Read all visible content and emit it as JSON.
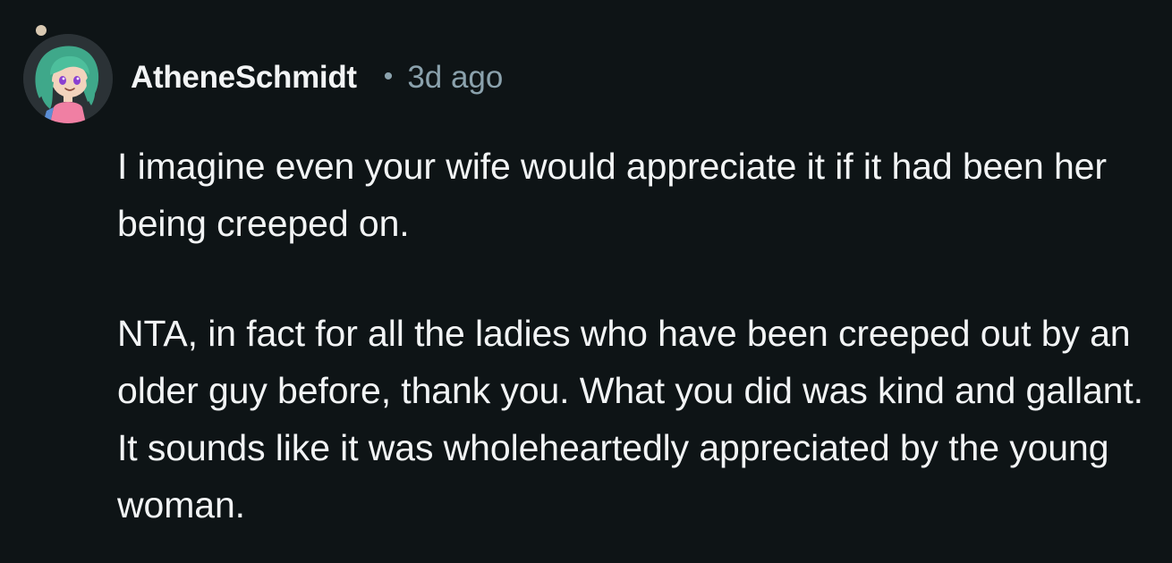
{
  "comment": {
    "author": "AtheneSchmidt",
    "separator": "•",
    "timestamp": "3d ago",
    "paragraphs": [
      "I imagine even your wife would appreciate it if it had been her being creeped on.",
      "NTA, in fact for all the ladies who have been creeped out by an older guy before, thank you. What you did was kind and gallant. It sounds like it was wholeheartedly appreciated by the young woman."
    ],
    "avatar_icon": "user-avatar-icon"
  },
  "colors": {
    "background": "#0e1416",
    "text": "#f2f4f5",
    "meta": "#8ba2ad",
    "avatar_hair": "#3fa88a",
    "avatar_eyes": "#8a3fd1",
    "avatar_shirt": "#f07fa3"
  }
}
